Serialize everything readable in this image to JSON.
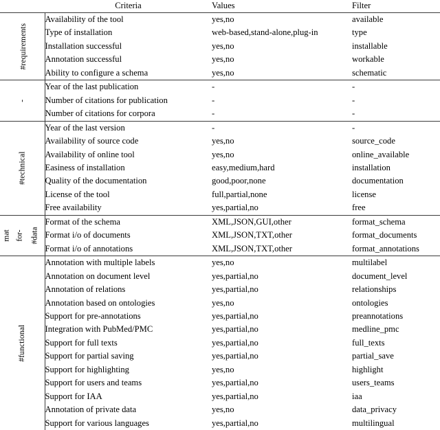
{
  "table": {
    "headers": {
      "group": "",
      "criteria": "Criteria",
      "values": "Values",
      "filter": "Filter"
    },
    "groups": [
      {
        "label": "#requirements",
        "label_lines": [
          "#requirements"
        ],
        "rows": [
          {
            "criteria": "Availability of the tool",
            "values": "yes,no",
            "filter": "available"
          },
          {
            "criteria": "Type of installation",
            "values": "web-based,stand-alone,plug-in",
            "filter": "type"
          },
          {
            "criteria": "Installation successful",
            "values": "yes,no",
            "filter": "installable"
          },
          {
            "criteria": "Annotation successful",
            "values": "yes,no",
            "filter": "workable"
          },
          {
            "criteria": "Ability to configure a schema",
            "values": "yes,no",
            "filter": "schematic"
          }
        ]
      },
      {
        "label": "-",
        "label_lines": [
          "-"
        ],
        "rows": [
          {
            "criteria": "Year of the last publication",
            "values": "-",
            "filter": "-"
          },
          {
            "criteria": "Number of citations for publication",
            "values": "-",
            "filter": "-"
          },
          {
            "criteria": "Number of citations for corpora",
            "values": "-",
            "filter": "-"
          }
        ]
      },
      {
        "label": "#technical",
        "label_lines": [
          "#technical"
        ],
        "rows": [
          {
            "criteria": "Year of the last version",
            "values": "-",
            "filter": "-"
          },
          {
            "criteria": "Availability of source code",
            "values": "yes,no",
            "filter": "source_code"
          },
          {
            "criteria": "Availability of online tool",
            "values": "yes,no",
            "filter": "online_available"
          },
          {
            "criteria": "Easiness of installation",
            "values": "easy,medium,hard",
            "filter": "installation"
          },
          {
            "criteria": "Quality of the documentation",
            "values": "good,poor,none",
            "filter": "documentation"
          },
          {
            "criteria": "License of the tool",
            "values": "full,partial,none",
            "filter": "license"
          },
          {
            "criteria": "Free availability",
            "values": "yes,partial,no",
            "filter": "free"
          }
        ]
      },
      {
        "label": "#data for-mat",
        "label_lines": [
          "#data",
          "for-",
          "mat"
        ],
        "rows": [
          {
            "criteria": "Format of the schema",
            "values": "XML,JSON,GUI,other",
            "filter": "format_schema"
          },
          {
            "criteria": "Format i/o of documents",
            "values": "XML,JSON,TXT,other",
            "filter": "format_documents"
          },
          {
            "criteria": "Format i/o of annotations",
            "values": "XML,JSON,TXT,other",
            "filter": "format_annotations"
          }
        ]
      },
      {
        "label": "#functional",
        "label_lines": [
          "#functional"
        ],
        "rows": [
          {
            "criteria": "Annotation with multiple labels",
            "values": "yes,no",
            "filter": "multilabel"
          },
          {
            "criteria": "Annotation on document level",
            "values": "yes,partial,no",
            "filter": "document_level"
          },
          {
            "criteria": "Annotation of relations",
            "values": "yes,partial,no",
            "filter": "relationships"
          },
          {
            "criteria": "Annotation based on ontologies",
            "values": "yes,no",
            "filter": "ontologies"
          },
          {
            "criteria": "Support for pre-annotations",
            "values": "yes,partial,no",
            "filter": "preannotations"
          },
          {
            "criteria": "Integration with PubMed/PMC",
            "values": "yes,partial,no",
            "filter": "medline_pmc"
          },
          {
            "criteria": "Support for full texts",
            "values": "yes,partial,no",
            "filter": "full_texts"
          },
          {
            "criteria": "Support for partial saving",
            "values": "yes,partial,no",
            "filter": "partial_save"
          },
          {
            "criteria": "Support for highlighting",
            "values": "yes,no",
            "filter": "highlight"
          },
          {
            "criteria": "Support for users and teams",
            "values": "yes,partial,no",
            "filter": "users_teams"
          },
          {
            "criteria": "Support for IAA",
            "values": "yes,partial,no",
            "filter": "iaa"
          },
          {
            "criteria": "Annotation of private data",
            "values": "yes,no",
            "filter": "data_privacy"
          },
          {
            "criteria": "Support for various languages",
            "values": "yes,partial,no",
            "filter": "multilingual"
          }
        ]
      }
    ]
  }
}
